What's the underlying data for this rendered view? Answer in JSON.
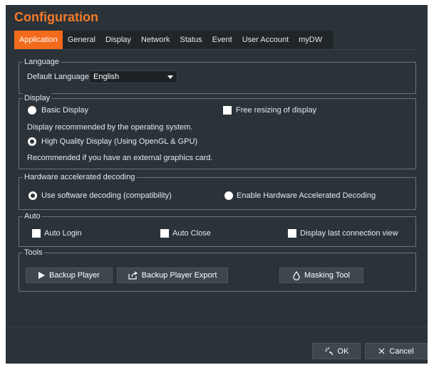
{
  "window": {
    "title": "Configuration"
  },
  "tabs": [
    {
      "label": "Application",
      "active": true
    },
    {
      "label": "General",
      "active": false
    },
    {
      "label": "Display",
      "active": false
    },
    {
      "label": "Network",
      "active": false
    },
    {
      "label": "Status",
      "active": false
    },
    {
      "label": "Event",
      "active": false
    },
    {
      "label": "User Account",
      "active": false
    },
    {
      "label": "myDW",
      "active": false
    }
  ],
  "language": {
    "group_label": "Language",
    "default_label": "Default Language",
    "selected": "English"
  },
  "display": {
    "group_label": "Display",
    "basic_label": "Basic Display",
    "basic_note": "Display recommended by the operating system.",
    "hq_label": "High Quality Display (Using OpenGL & GPU)",
    "hq_note": "Recommended if you have an external graphics card.",
    "free_resize_label": "Free resizing of display",
    "selected": "hq",
    "free_resize_checked": false
  },
  "decoding": {
    "group_label": "Hardware accelerated decoding",
    "software_label": "Use software decoding (compatibility)",
    "hardware_label": "Enable Hardware Accelerated Decoding",
    "selected": "software"
  },
  "auto": {
    "group_label": "Auto",
    "auto_login_label": "Auto Login",
    "auto_close_label": "Auto Close",
    "last_view_label": "Display last connection view",
    "auto_login_checked": false,
    "auto_close_checked": false,
    "last_view_checked": false
  },
  "tools": {
    "group_label": "Tools",
    "backup_player_label": "Backup Player",
    "backup_export_label": "Backup Player Export",
    "masking_tool_label": "Masking Tool"
  },
  "footer": {
    "ok_label": "OK",
    "cancel_label": "Cancel"
  },
  "colors": {
    "accent": "#f26a1b",
    "title": "#f47a2a",
    "background": "#2b3338"
  }
}
